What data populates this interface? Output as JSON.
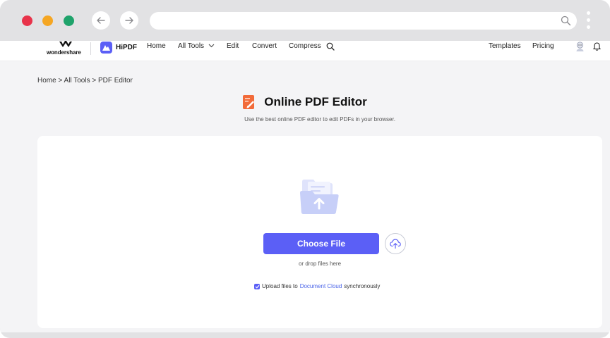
{
  "browser": {
    "url": ""
  },
  "nav": {
    "logo_text": "wondershare",
    "product_name": "HiPDF",
    "home": "Home",
    "all_tools": "All Tools",
    "edit": "Edit",
    "convert": "Convert",
    "compress": "Compress",
    "templates": "Templates",
    "pricing": "Pricing"
  },
  "breadcrumb": "Home > All Tools > PDF Editor",
  "page": {
    "title": "Online PDF Editor",
    "subtitle": "Use the best online PDF editor to edit PDFs in your browser."
  },
  "upload": {
    "choose_file": "Choose File",
    "drop_text": "or drop files here",
    "sync_prefix": "Upload files to",
    "sync_link": "Document Cloud",
    "sync_suffix": "synchronously",
    "sync_checked": true
  },
  "colors": {
    "accent": "#5b5ff6",
    "link": "#4a64e8",
    "title_icon": "#f26b3a"
  }
}
